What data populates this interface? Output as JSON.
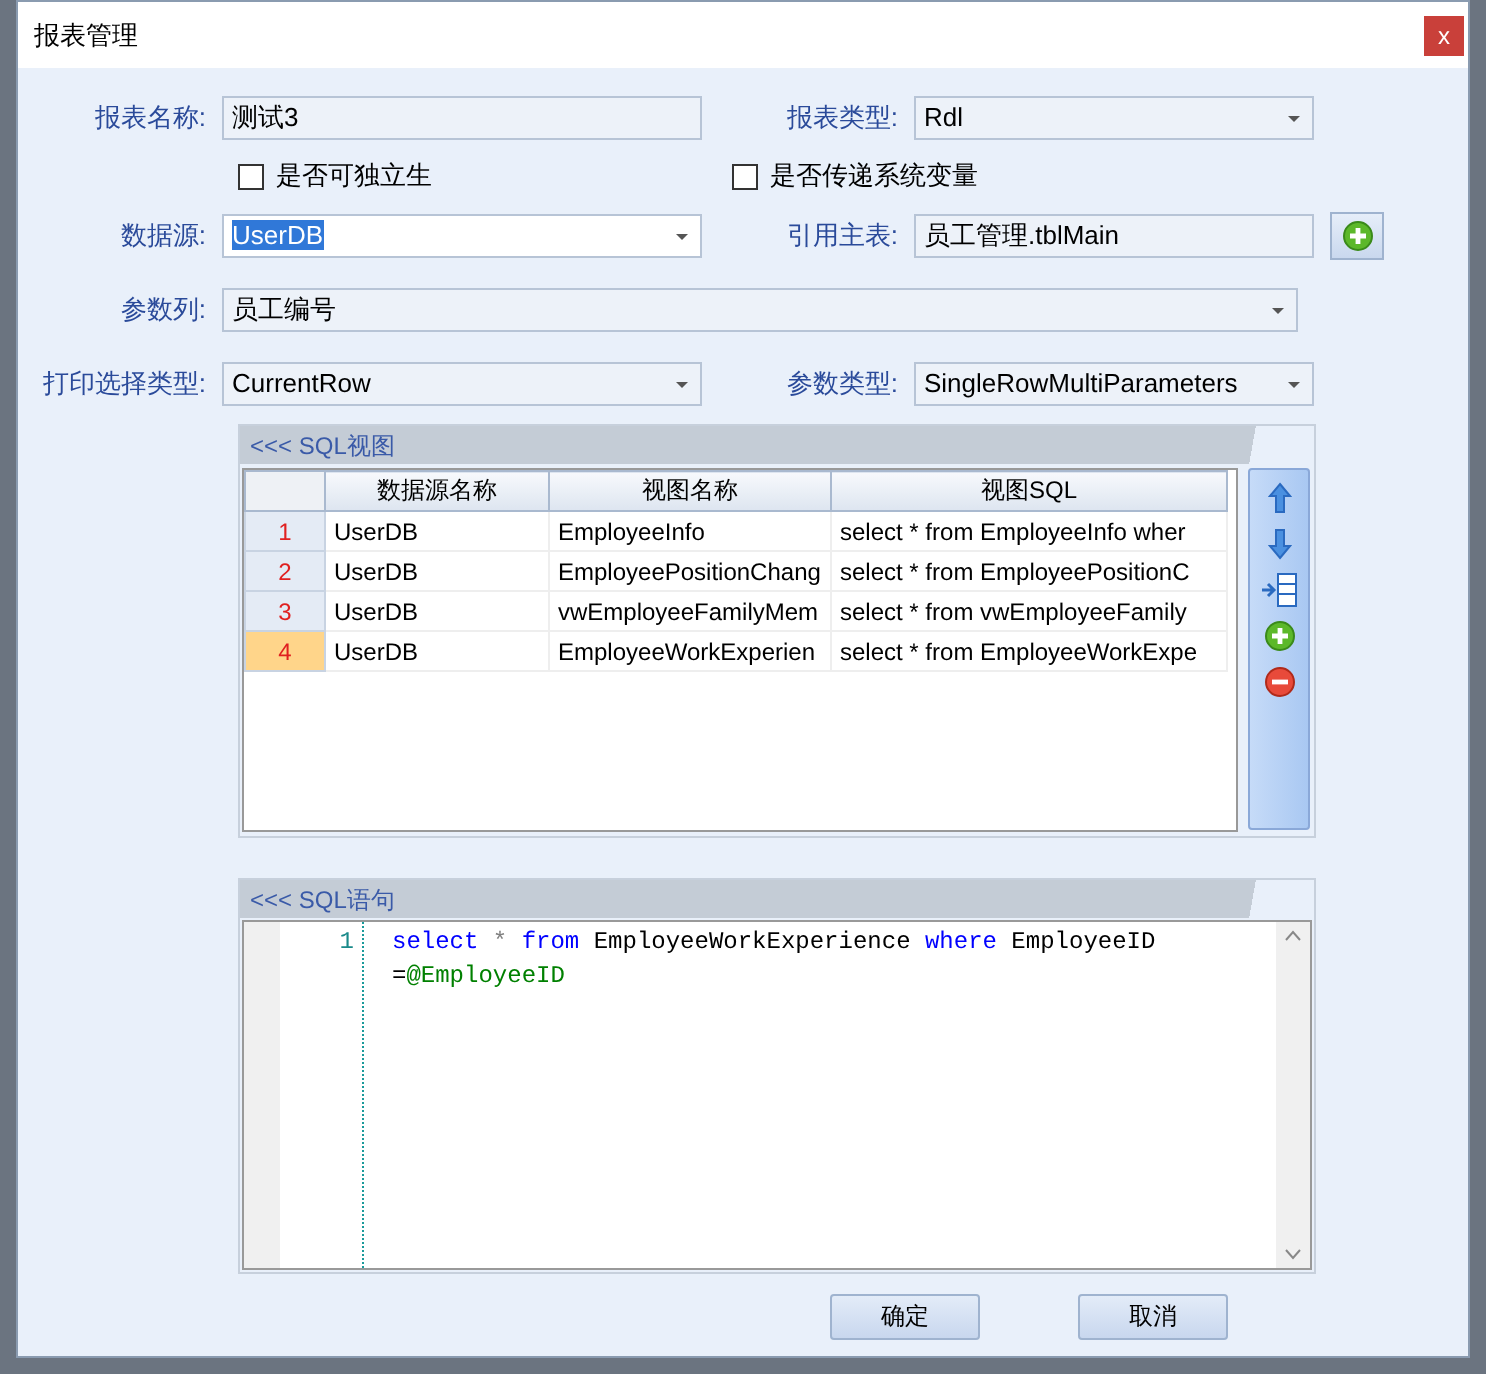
{
  "window": {
    "title": "报表管理",
    "close": "x"
  },
  "form": {
    "report_name": {
      "label": "报表名称:",
      "value": "测试3"
    },
    "report_type": {
      "label": "报表类型:",
      "value": "Rdl"
    },
    "checkboxes": [
      {
        "label": "是否可独立生",
        "checked": false
      },
      {
        "label": "是否传递系统变量",
        "checked": false
      }
    ],
    "data_source": {
      "label": "数据源:",
      "value": "UserDB",
      "highlighted": true
    },
    "main_table": {
      "label": "引用主表:",
      "value": "员工管理.tblMain"
    },
    "param_column": {
      "label": "参数列:",
      "value": "员工编号"
    },
    "print_type": {
      "label": "打印选择类型:",
      "value": "CurrentRow"
    },
    "param_type": {
      "label": "参数类型:",
      "value": "SingleRowMultiParameters"
    }
  },
  "sql_view": {
    "title": "<<< SQL视图",
    "columns": [
      "数据源名称",
      "视图名称",
      "视图SQL"
    ],
    "rows": [
      {
        "number": "1",
        "selected": false,
        "cells": [
          "UserDB",
          "EmployeeInfo",
          "select * from EmployeeInfo wher"
        ]
      },
      {
        "number": "2",
        "selected": false,
        "cells": [
          "UserDB",
          "EmployeePositionChang",
          "select * from EmployeePositionC"
        ]
      },
      {
        "number": "3",
        "selected": false,
        "cells": [
          "UserDB",
          "vwEmployeeFamilyMem",
          "select * from vwEmployeeFamily"
        ]
      },
      {
        "number": "4",
        "selected": true,
        "cells": [
          "UserDB",
          "EmployeeWorkExperien",
          "select * from EmployeeWorkExpe"
        ]
      }
    ],
    "tools": [
      {
        "kind": "up"
      },
      {
        "kind": "down"
      },
      {
        "kind": "insert"
      },
      {
        "kind": "add"
      },
      {
        "kind": "remove"
      }
    ]
  },
  "sql_statement": {
    "title": "<<< SQL语句",
    "lines": [
      {
        "number": "1",
        "tokens": [
          {
            "text": "select",
            "kind": "keyword"
          },
          {
            "text": " *",
            "kind": "op"
          },
          {
            "text": " from",
            "kind": "keyword"
          },
          {
            "text": " EmployeeWorkExperience ",
            "kind": "plain"
          },
          {
            "text": "where",
            "kind": "keyword"
          },
          {
            "text": " EmployeeID",
            "kind": "plain"
          }
        ]
      },
      {
        "tokens": [
          {
            "text": "=",
            "kind": "plain"
          },
          {
            "text": "@EmployeeID",
            "kind": "param"
          }
        ]
      }
    ]
  },
  "buttons": [
    "确定",
    "取消"
  ]
}
